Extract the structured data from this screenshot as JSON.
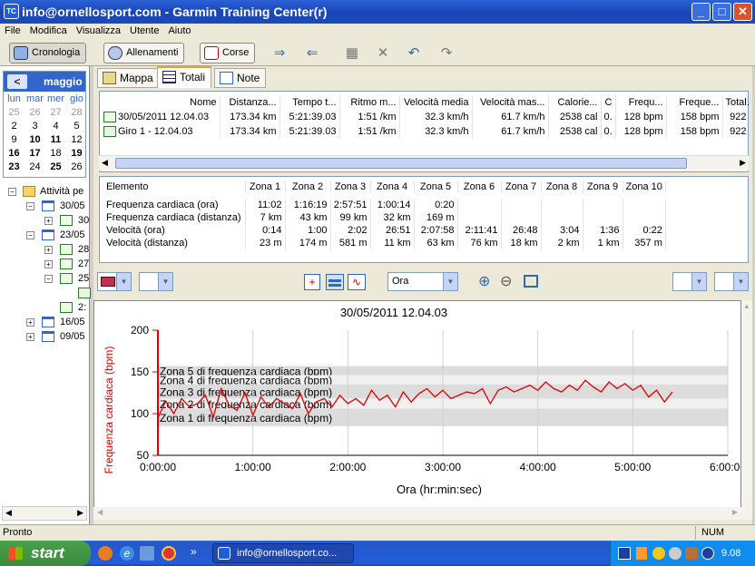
{
  "window": {
    "title": "info@ornellosport.com - Garmin Training Center(r)",
    "app_icon_text": "TC",
    "min": "_",
    "max": "□",
    "close": "✕"
  },
  "menu": [
    "File",
    "Modifica",
    "Visualizza",
    "Utente",
    "Aiuto"
  ],
  "toolbar": {
    "cronologia": "Cronologia",
    "allenamenti": "Allenamenti",
    "corse": "Corse"
  },
  "calendar": {
    "month": "maggio",
    "prev": "<",
    "days": [
      "lun",
      "mar",
      "mer",
      "gio"
    ],
    "weeks": [
      [
        "25",
        "26",
        "27",
        "28"
      ],
      [
        "2",
        "3",
        "4",
        "5"
      ],
      [
        "9",
        "10",
        "11",
        "12"
      ],
      [
        "16",
        "17",
        "18",
        "19"
      ],
      [
        "23",
        "24",
        "25",
        "26"
      ]
    ]
  },
  "tree": {
    "root": "Attività pe",
    "n1": "30/05",
    "n1a": "30",
    "n2": "23/05",
    "n2a": "28",
    "n2b": "27",
    "n2c": "25",
    "n2d": "2:",
    "n3": "16/05",
    "n4": "09/05"
  },
  "tabs": {
    "mappa": "Mappa",
    "totali": "Totali",
    "note": "Note"
  },
  "activities": {
    "headers": [
      "Nome",
      "Distanza...",
      "Tempo t...",
      "Ritmo m...",
      "Velocità media",
      "Velocità mas...",
      "Calorie...",
      "C",
      "Frequ...",
      "Freque...",
      "Total."
    ],
    "rows": [
      [
        "30/05/2011 12.04.03",
        "173.34 km",
        "5:21:39.03",
        "1:51 /km",
        "32.3 km/h",
        "61.7 km/h",
        "2538 cal",
        "0.",
        "128 bpm",
        "158 bpm",
        "922"
      ],
      [
        "Giro 1 - 12.04.03",
        "173.34 km",
        "5:21:39.03",
        "1:51 /km",
        "32.3 km/h",
        "61.7 km/h",
        "2538 cal",
        "0.",
        "128 bpm",
        "158 bpm",
        "922"
      ]
    ]
  },
  "zones": {
    "headers": [
      "Elemento",
      "Zona 1",
      "Zona 2",
      "Zona 3",
      "Zona 4",
      "Zona 5",
      "Zona 6",
      "Zona 7",
      "Zona 8",
      "Zona 9",
      "Zona 10"
    ],
    "rows": [
      [
        "Frequenza cardiaca (ora)",
        "11:02",
        "1:16:19",
        "2:57:51",
        "1:00:14",
        "0:20",
        "",
        "",
        "",
        "",
        ""
      ],
      [
        "Frequenza cardiaca (distanza)",
        "7 km",
        "43 km",
        "99 km",
        "32 km",
        "169 m",
        "",
        "",
        "",
        "",
        ""
      ],
      [
        "Velocità (ora)",
        "0:14",
        "1:00",
        "2:02",
        "26:51",
        "2:07:58",
        "2:11:41",
        "26:48",
        "3:04",
        "1:36",
        "0:22"
      ],
      [
        "Velocità (distanza)",
        "23 m",
        "174 m",
        "581 m",
        "11 km",
        "63 km",
        "76 km",
        "18 km",
        "2 km",
        "1 km",
        "357 m"
      ]
    ]
  },
  "chart_toolbar": {
    "xaxis_select": "Ora"
  },
  "chart_data": {
    "type": "line",
    "title": "30/05/2011 12.04.03",
    "xlabel": "Ora (hr:min:sec)",
    "ylabel": "Frequenza cardiaca (bpm)",
    "xlim": [
      0,
      21600
    ],
    "ylim": [
      50,
      200
    ],
    "xticks": [
      "0:00:00",
      "1:00:00",
      "2:00:00",
      "3:00:00",
      "4:00:00",
      "5:00:00",
      "6:00:00"
    ],
    "yticks": [
      "200",
      "150",
      "100",
      "50"
    ],
    "zones": [
      {
        "name": "Zona 5 di frequenza cardiaca (bpm)",
        "min": 146,
        "max": 157
      },
      {
        "name": "Zona 4 di frequenza cardiaca (bpm)",
        "min": 135,
        "max": 146
      },
      {
        "name": "Zona 3 di frequenza cardiaca (bpm)",
        "min": 118,
        "max": 135
      },
      {
        "name": "Zona 2 di frequenza cardiaca (bpm)",
        "min": 106,
        "max": 118
      },
      {
        "name": "Zona 1 di frequenza cardiaca (bpm)",
        "min": 85,
        "max": 106
      }
    ],
    "series": [
      {
        "color": "#e00000",
        "x": [
          0,
          300,
          600,
          900,
          1200,
          1500,
          1800,
          2100,
          2400,
          2700,
          3000,
          3300,
          3600,
          3900,
          4200,
          4500,
          4800,
          5100,
          5400,
          5700,
          6000,
          6300,
          6600,
          6900,
          7200,
          7500,
          7800,
          8100,
          8400,
          8700,
          9000,
          9300,
          9600,
          9900,
          10200,
          10500,
          10800,
          11100,
          11400,
          11700,
          12000,
          12300,
          12600,
          12900,
          13200,
          13500,
          13800,
          14100,
          14400,
          14700,
          15000,
          15300,
          15600,
          15900,
          16200,
          16500,
          16800,
          17100,
          17400,
          17700,
          18000,
          18300,
          18600,
          18900,
          19200,
          19500
        ],
        "y": [
          95,
          115,
          100,
          118,
          108,
          112,
          122,
          96,
          130,
          110,
          104,
          125,
          98,
          120,
          108,
          118,
          112,
          106,
          124,
          100,
          114,
          118,
          108,
          122,
          112,
          118,
          110,
          128,
          116,
          122,
          108,
          126,
          114,
          124,
          130,
          120,
          128,
          118,
          122,
          126,
          124,
          130,
          112,
          128,
          132,
          126,
          130,
          134,
          128,
          138,
          130,
          126,
          134,
          128,
          140,
          132,
          126,
          138,
          130,
          136,
          128,
          134,
          120,
          128,
          114,
          126
        ]
      }
    ]
  },
  "status": {
    "left": "Pronto",
    "right": "NUM"
  },
  "taskbar": {
    "start": "start",
    "task": "info@ornellosport.co...",
    "clock": "9.08",
    "chevron": "»"
  }
}
